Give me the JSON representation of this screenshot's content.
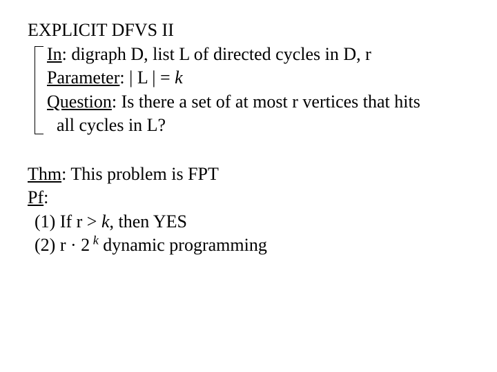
{
  "block1": {
    "title": "EXPLICIT DFVS II",
    "in_label": "In",
    "in_text": ": digraph D, list L of directed cycles in D, r",
    "param_label": "Parameter",
    "param_text": ":  | L | = ",
    "param_k": "k",
    "question_label": "Question",
    "question_text1": ":  Is there a set of at most r vertices that hits",
    "question_text2": "all cycles in L?"
  },
  "block2": {
    "thm_label": "Thm",
    "thm_text": ":  This problem is FPT",
    "pf_label": "Pf",
    "pf_colon": ":",
    "item1_a": "(1) If r > ",
    "item1_k": "k",
    "item1_b": ", then YES",
    "item2_a": "(2) r · 2",
    "item2_exp": " k",
    "item2_b": "  dynamic programming"
  }
}
